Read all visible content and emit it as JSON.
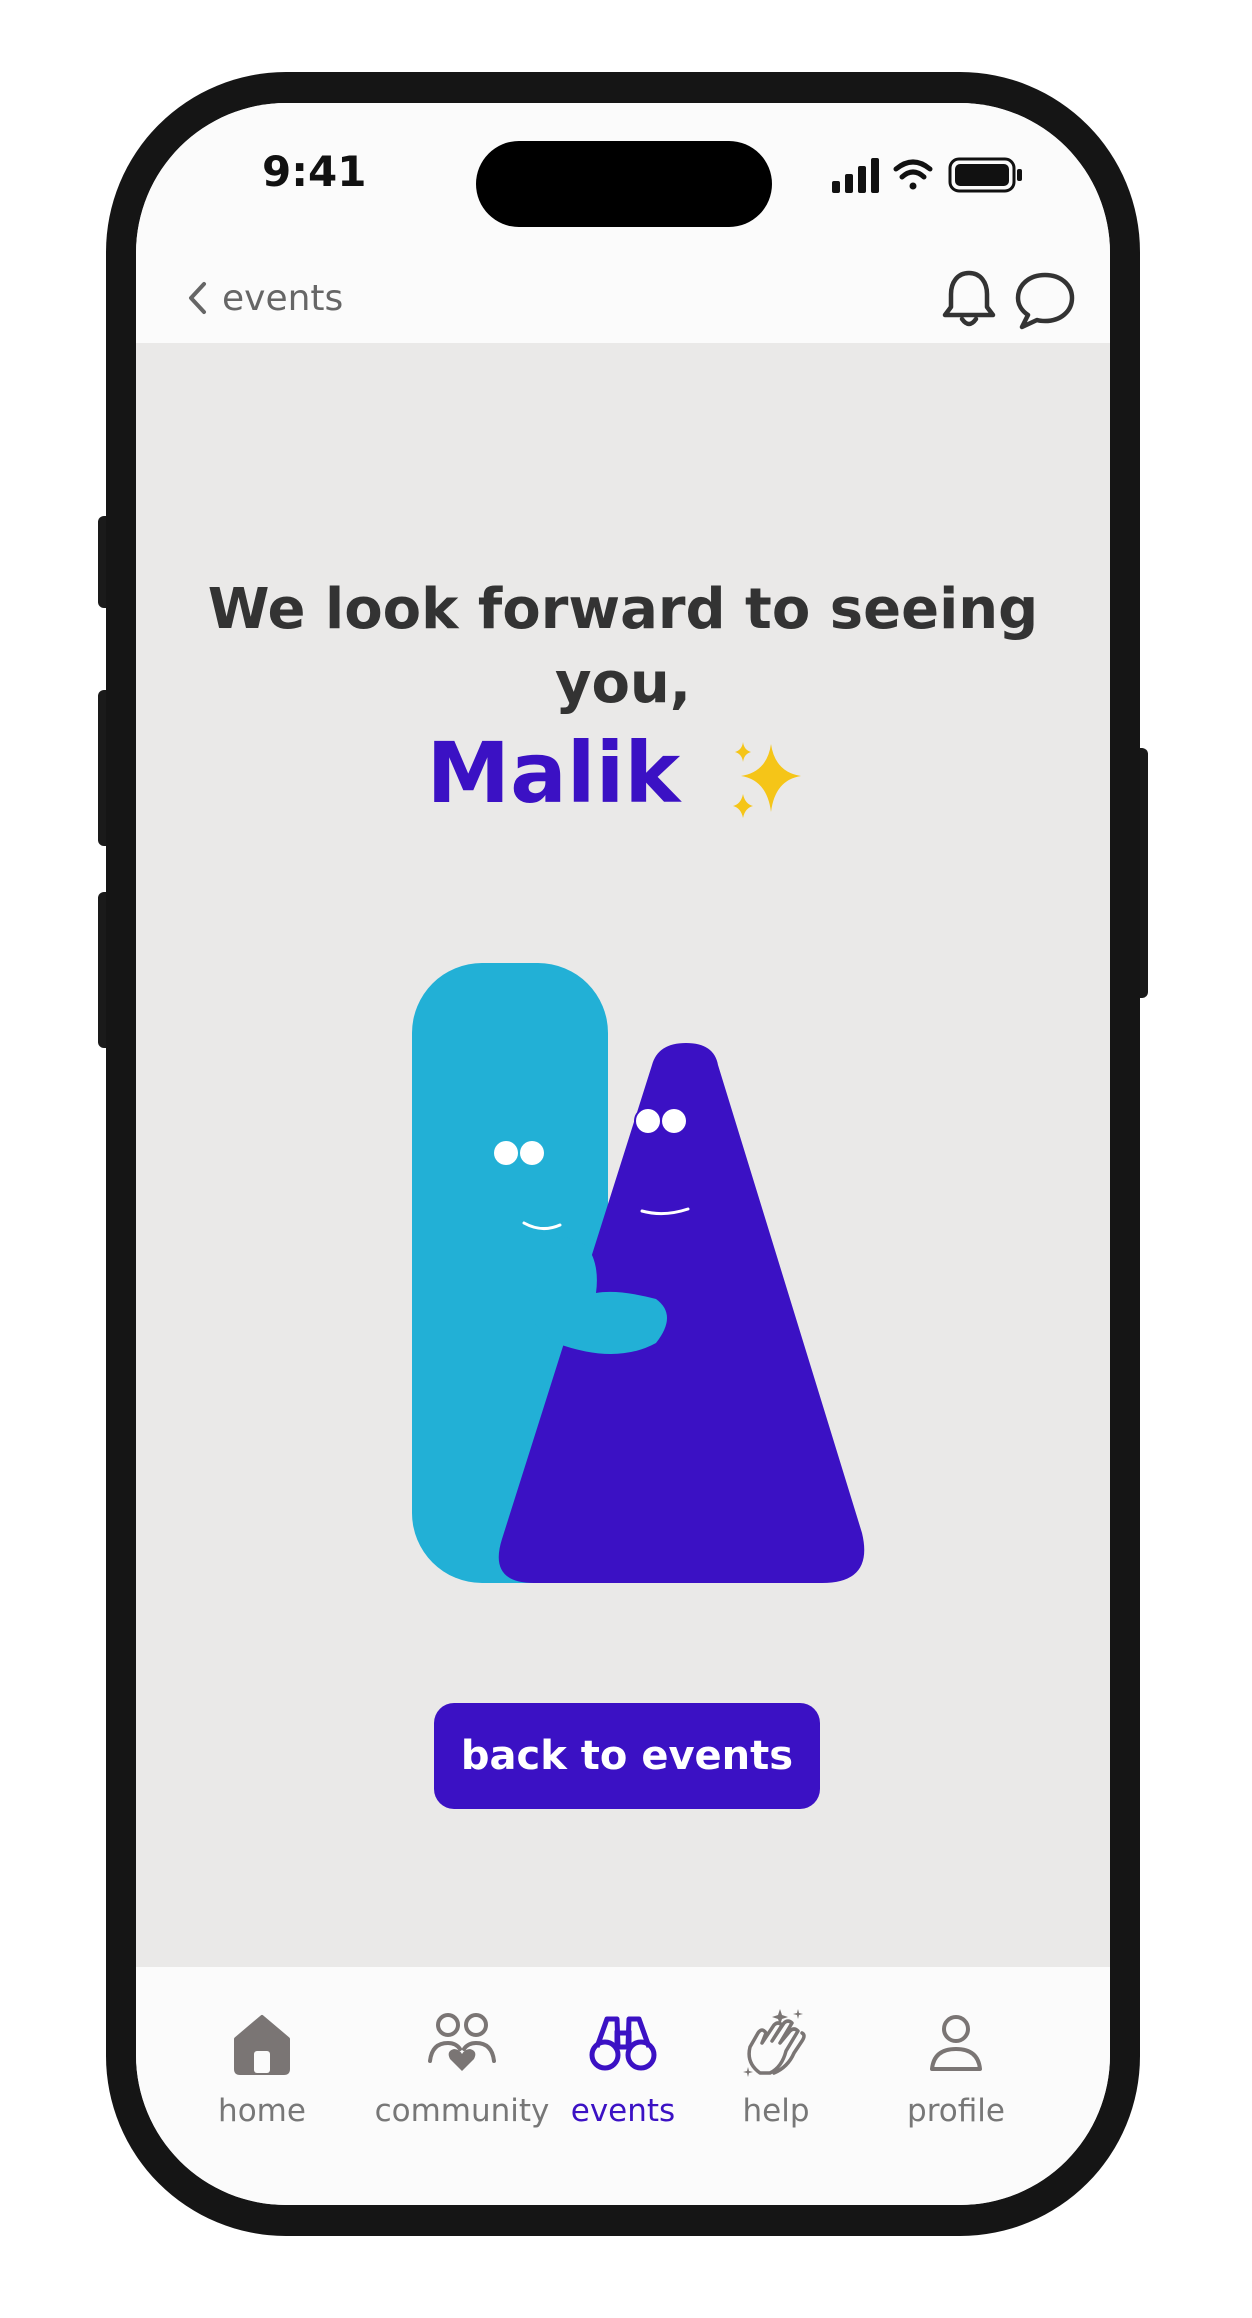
{
  "status": {
    "time": "9:41"
  },
  "header": {
    "back_label": "events"
  },
  "main": {
    "title": "We look forward to seeing you,",
    "name": "Malik",
    "cta_label": "back to events"
  },
  "tabs": [
    {
      "label": "home",
      "icon": "home-icon"
    },
    {
      "label": "community",
      "icon": "community-icon"
    },
    {
      "label": "events",
      "icon": "binoculars-icon",
      "active": true
    },
    {
      "label": "help",
      "icon": "clapping-hands-icon"
    },
    {
      "label": "profile",
      "icon": "profile-icon"
    }
  ],
  "colors": {
    "brand": "#3b11c4",
    "character_blue": "#22b0d6",
    "background": "#eae9e8"
  }
}
